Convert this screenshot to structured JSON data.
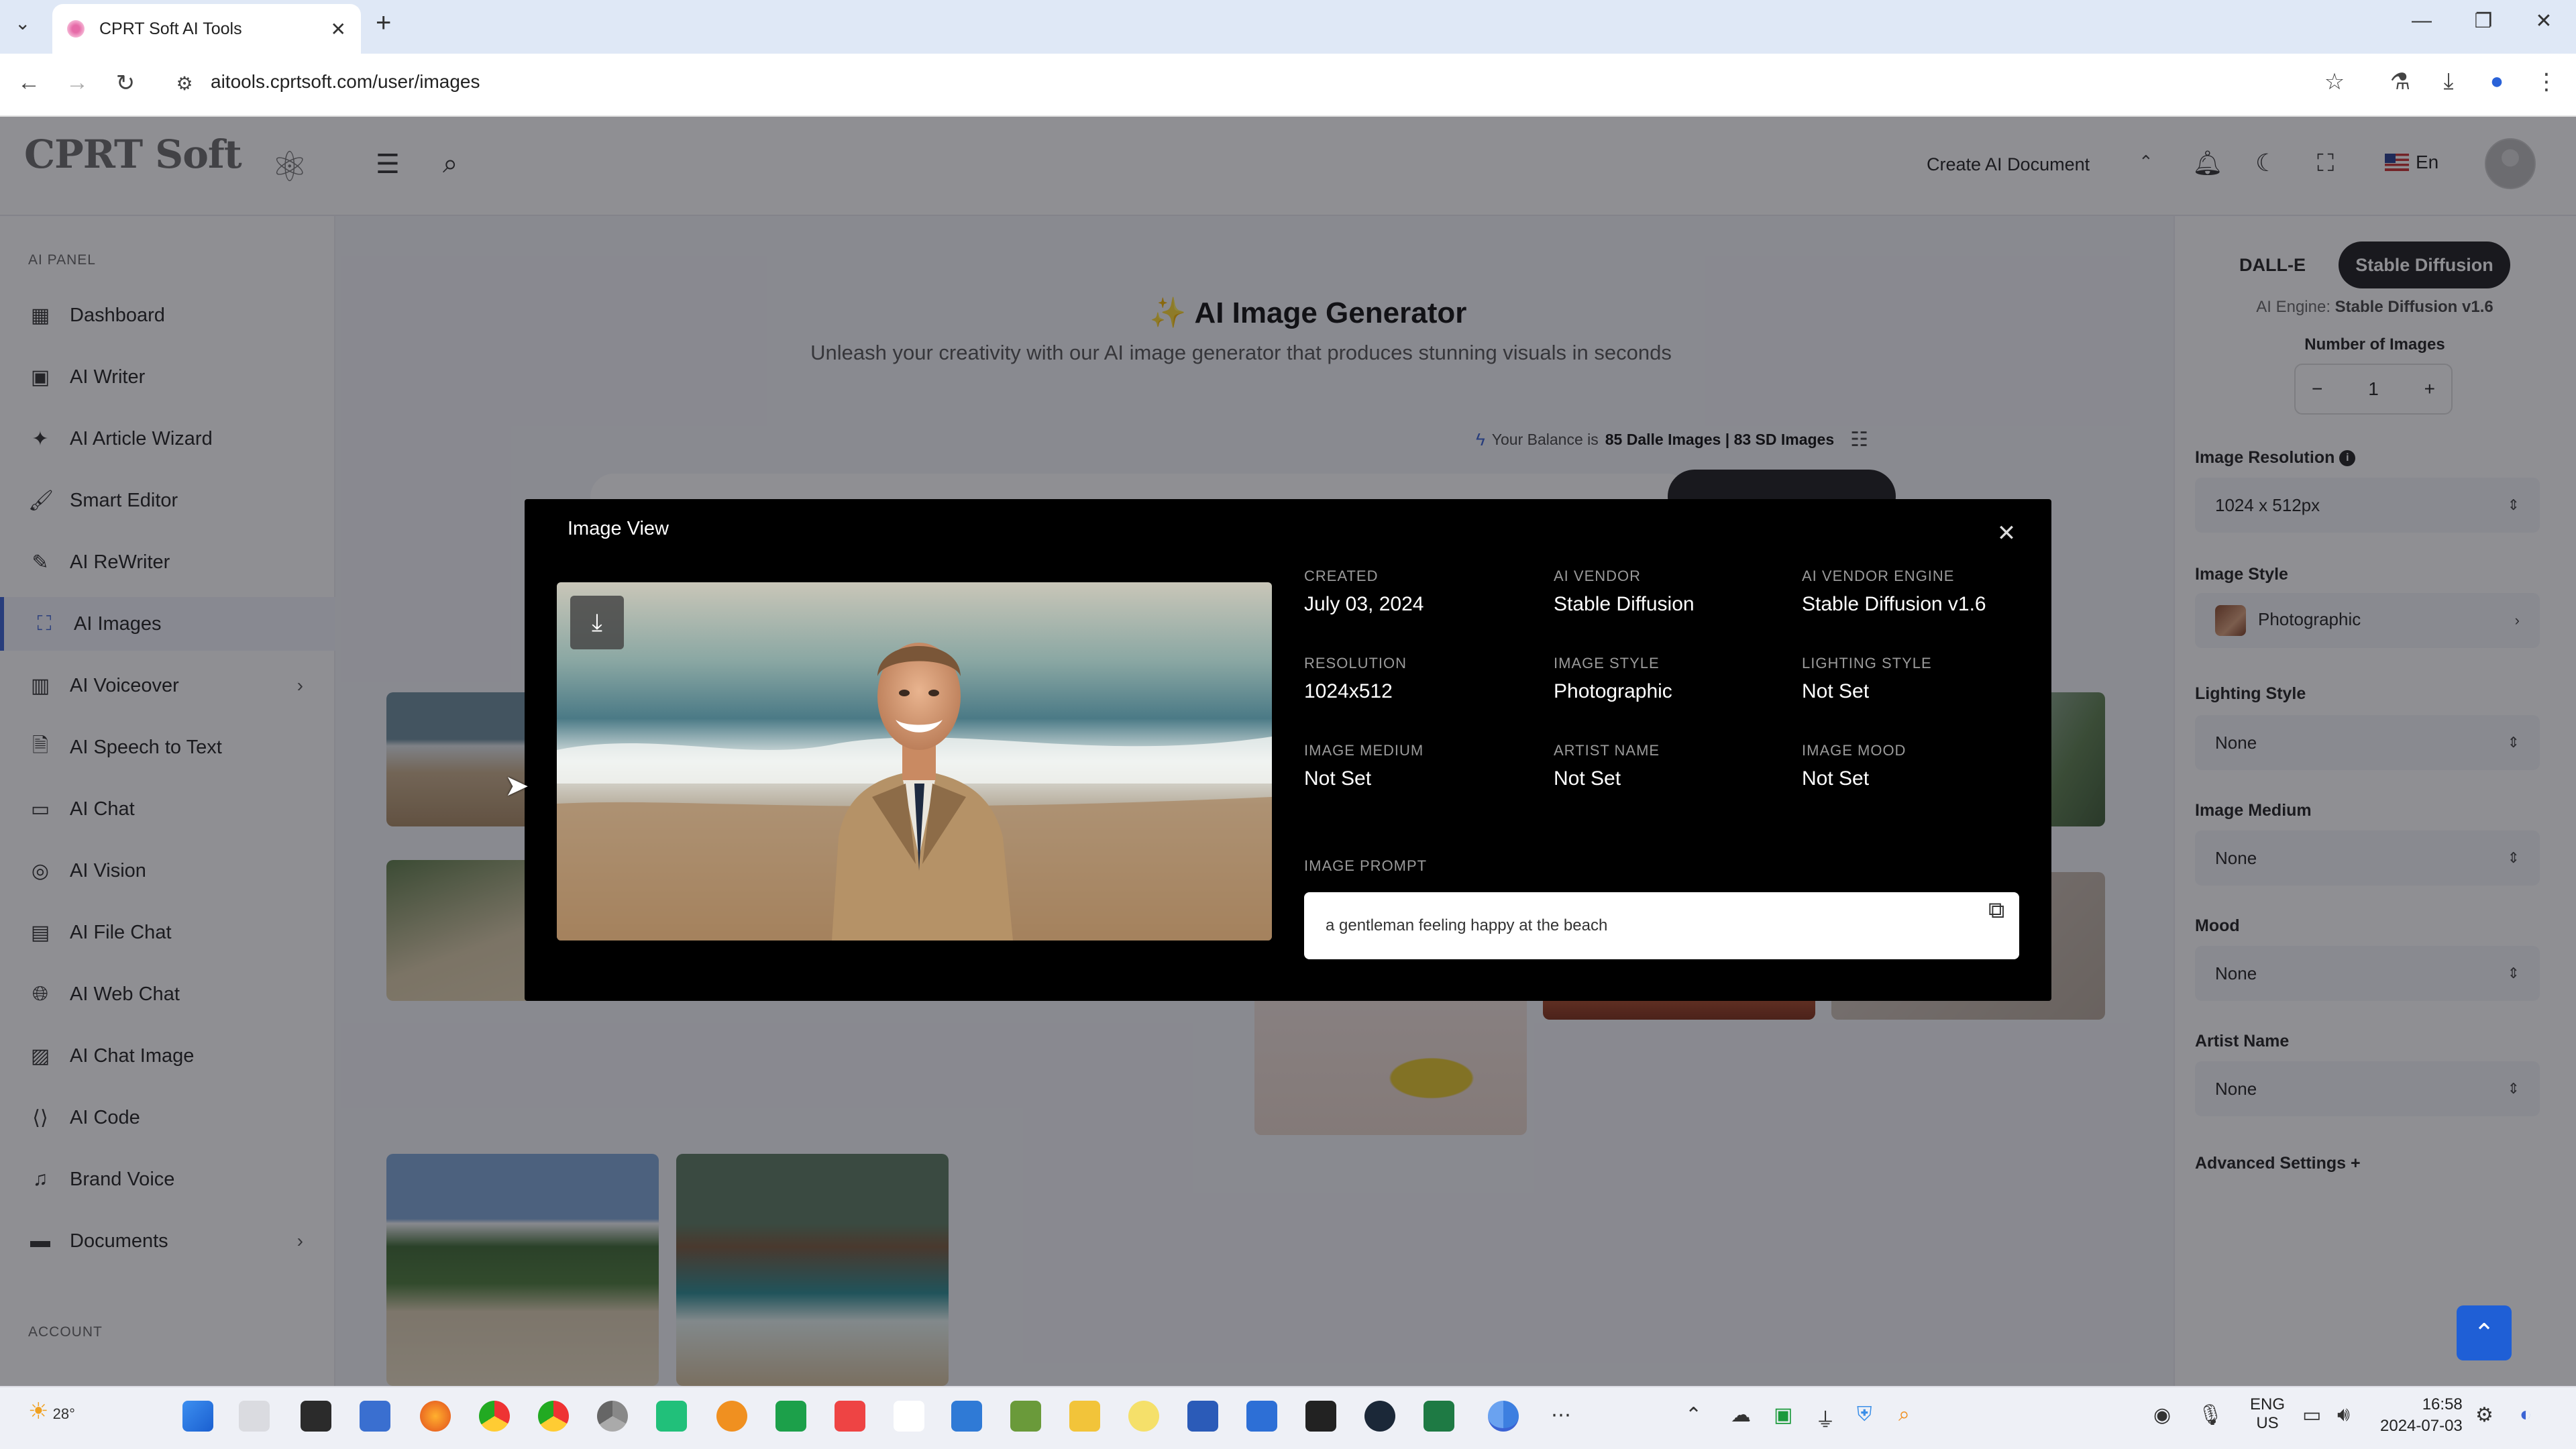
{
  "browser": {
    "tab_title": "CPRT Soft AI Tools",
    "url": "aitools.cprtsoft.com/user/images"
  },
  "header": {
    "logo_text": "CPRT Soft",
    "create_doc_label": "Create AI Document",
    "language": "En"
  },
  "sidebar": {
    "section_ai": "AI PANEL",
    "section_account": "ACCOUNT",
    "items": [
      {
        "label": "Dashboard",
        "icon": "dashboard-icon"
      },
      {
        "label": "AI Writer",
        "icon": "cpu-icon"
      },
      {
        "label": "AI Article Wizard",
        "icon": "sparkles-icon"
      },
      {
        "label": "Smart Editor",
        "icon": "brush-icon"
      },
      {
        "label": "AI ReWriter",
        "icon": "pen-icon"
      },
      {
        "label": "AI Images",
        "icon": "image-scan-icon"
      },
      {
        "label": "AI Voiceover",
        "icon": "waveform-icon"
      },
      {
        "label": "AI Speech to Text",
        "icon": "file-audio-icon"
      },
      {
        "label": "AI Chat",
        "icon": "chat-icon"
      },
      {
        "label": "AI Vision",
        "icon": "vision-icon"
      },
      {
        "label": "AI File Chat",
        "icon": "file-chat-icon"
      },
      {
        "label": "AI Web Chat",
        "icon": "globe-icon"
      },
      {
        "label": "AI Chat Image",
        "icon": "chat-image-icon"
      },
      {
        "label": "AI Code",
        "icon": "code-icon"
      },
      {
        "label": "Brand Voice",
        "icon": "brand-voice-icon"
      },
      {
        "label": "Documents",
        "icon": "folder-icon"
      }
    ]
  },
  "main": {
    "title": "AI Image Generator",
    "subtitle": "Unleash your creativity with our AI image generator that produces stunning visuals in seconds",
    "balance_prefix": "Your Balance is",
    "balance_value": "85 Dalle Images | 83 SD Images"
  },
  "right_panel": {
    "engine_dalle": "DALL-E",
    "engine_sd": "Stable Diffusion",
    "ai_engine_label": "AI Engine:",
    "ai_engine_value": "Stable Diffusion v1.6",
    "num_images_label": "Number of Images",
    "num_images_value": "1",
    "resolution_label": "Image Resolution",
    "resolution_value": "1024 x 512px",
    "style_label": "Image Style",
    "style_value": "Photographic",
    "lighting_label": "Lighting Style",
    "lighting_value": "None",
    "medium_label": "Image Medium",
    "medium_value": "None",
    "mood_label": "Mood",
    "mood_value": "None",
    "artist_label": "Artist Name",
    "artist_value": "None",
    "advanced_label": "Advanced Settings +"
  },
  "modal": {
    "title": "Image View",
    "meta": [
      {
        "key": "CREATED",
        "value": "July 03, 2024"
      },
      {
        "key": "AI VENDOR",
        "value": "Stable Diffusion"
      },
      {
        "key": "AI VENDOR ENGINE",
        "value": "Stable Diffusion v1.6"
      },
      {
        "key": "RESOLUTION",
        "value": "1024x512"
      },
      {
        "key": "IMAGE STYLE",
        "value": "Photographic"
      },
      {
        "key": "LIGHTING STYLE",
        "value": "Not Set"
      },
      {
        "key": "IMAGE MEDIUM",
        "value": "Not Set"
      },
      {
        "key": "ARTIST NAME",
        "value": "Not Set"
      },
      {
        "key": "IMAGE MOOD",
        "value": "Not Set"
      }
    ],
    "prompt_label": "IMAGE PROMPT",
    "prompt_text": "a gentleman feeling happy at the beach"
  },
  "taskbar": {
    "weather": "28°",
    "lang_1": "ENG",
    "lang_2": "US",
    "time": "16:58",
    "date": "2024-07-03"
  },
  "colors": {
    "accent": "#3b63d4",
    "modal_bg": "#000000",
    "engine_active_bg": "#1d1d1f"
  }
}
